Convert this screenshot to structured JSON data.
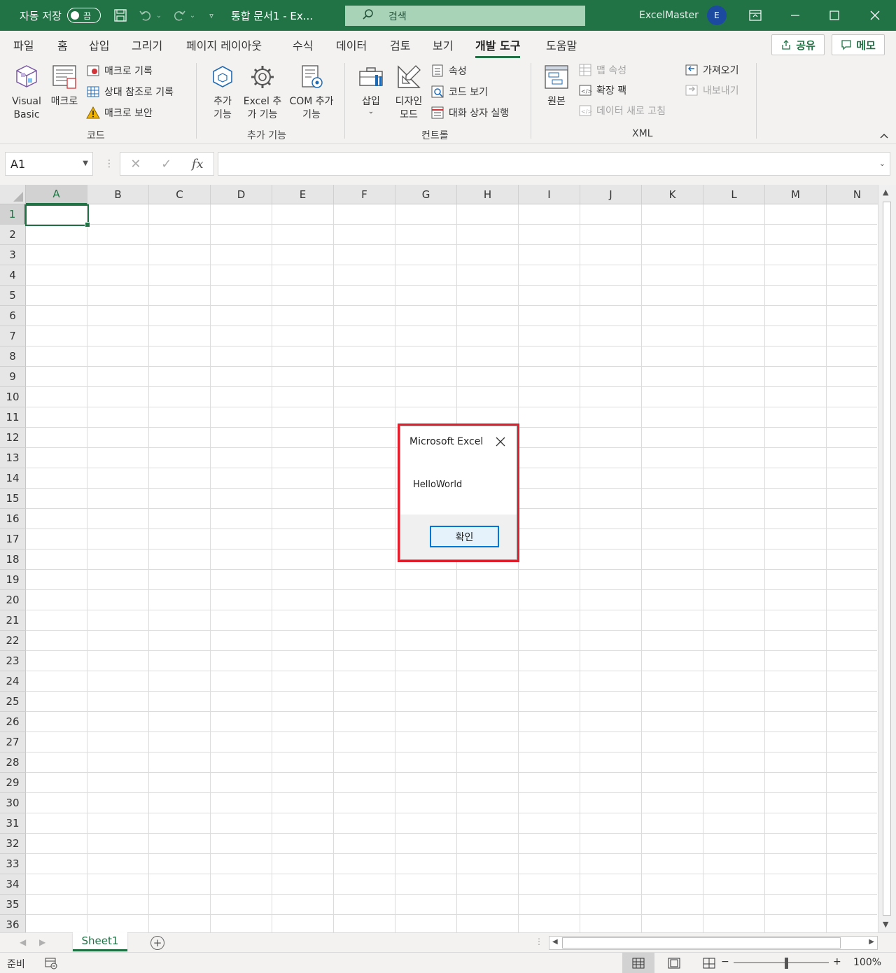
{
  "titlebar": {
    "autosave_label": "자동 저장",
    "autosave_state": "끔",
    "doc_title": "통합 문서1  -  Ex...",
    "search_placeholder": "검색",
    "user_name": "ExcelMaster",
    "user_initial": "E"
  },
  "menu": {
    "tabs": [
      "파일",
      "홈",
      "삽입",
      "그리기",
      "페이지 레이아웃",
      "수식",
      "데이터",
      "검토",
      "보기",
      "개발 도구",
      "도움말"
    ],
    "active_tab": "개발 도구",
    "share_label": "공유",
    "memo_label": "메모"
  },
  "ribbon": {
    "code": {
      "label": "코드",
      "visual_basic": "Visual Basic",
      "macro": "매크로",
      "record_macro": "매크로 기록",
      "relative_ref": "상대 참조로 기록",
      "macro_security": "매크로 보안"
    },
    "addins": {
      "label": "추가 기능",
      "addins": "추가 기능",
      "excel_addins": "Excel 추가 기능",
      "com_addins": "COM 추가 기능"
    },
    "controls": {
      "label": "컨트롤",
      "insert": "삽입",
      "design_mode": "디자인 모드",
      "properties": "속성",
      "view_code": "코드 보기",
      "run_dialog": "대화 상자 실행"
    },
    "xml": {
      "label": "XML",
      "source": "원본",
      "map_properties": "맵 속성",
      "expansion_packs": "확장 팩",
      "refresh_data": "데이터 새로 고침",
      "import": "가져오기",
      "export": "내보내기"
    }
  },
  "formula_bar": {
    "name_box": "A1",
    "formula": ""
  },
  "grid": {
    "columns": [
      "A",
      "B",
      "C",
      "D",
      "E",
      "F",
      "G",
      "H",
      "I",
      "J",
      "K",
      "L",
      "M",
      "N"
    ],
    "rows": [
      "1",
      "2",
      "3",
      "4",
      "5",
      "6",
      "7",
      "8",
      "9",
      "10",
      "11",
      "12",
      "13",
      "14",
      "15",
      "16",
      "17",
      "18",
      "19",
      "20",
      "21",
      "22",
      "23",
      "24",
      "25",
      "26",
      "27",
      "28",
      "29",
      "30",
      "31",
      "32",
      "33",
      "34",
      "35",
      "36"
    ],
    "active_cell": "A1"
  },
  "dialog": {
    "title": "Microsoft Excel",
    "message": "HelloWorld",
    "ok_label": "확인",
    "highlight_color": "#e01e2c"
  },
  "sheets": {
    "tabs": [
      "Sheet1"
    ],
    "active": "Sheet1"
  },
  "status": {
    "ready": "준비",
    "zoom": "100%"
  },
  "colors": {
    "brand": "#217346",
    "accent": "#0078d7"
  }
}
